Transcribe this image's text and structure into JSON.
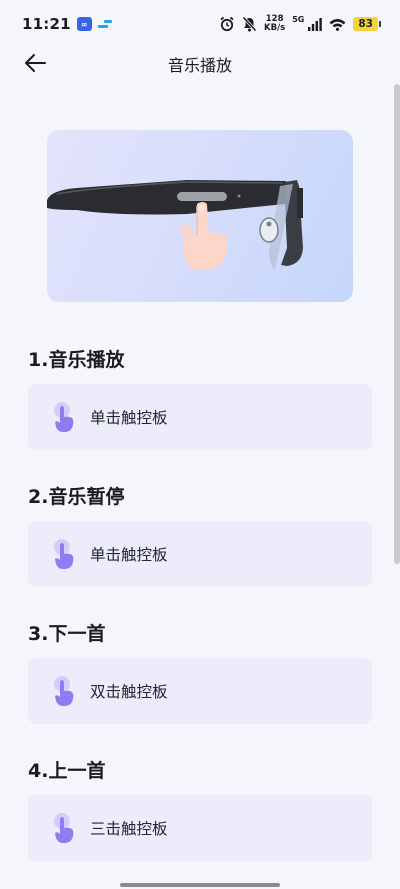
{
  "status_bar": {
    "time": "11:21",
    "net_speed_value": "128",
    "net_speed_unit": "KB/s",
    "network": "5G",
    "battery": "83"
  },
  "header": {
    "title": "音乐播放"
  },
  "sections": [
    {
      "heading": "1.音乐播放",
      "gesture": "单击触控板"
    },
    {
      "heading": "2.音乐暂停",
      "gesture": "单击触控板"
    },
    {
      "heading": "3.下一首",
      "gesture": "双击触控板"
    },
    {
      "heading": "4.上一首",
      "gesture": "三击触控板"
    }
  ],
  "colors": {
    "accent": "#8e7df0",
    "card_bg": "#ececfa",
    "page_bg": "#f5f6fb",
    "battery": "#f3d23a"
  }
}
